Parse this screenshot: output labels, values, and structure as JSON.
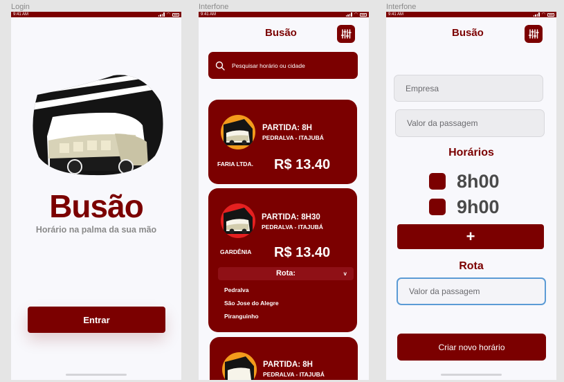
{
  "frames": {
    "login": "Login",
    "list": "Interfone",
    "form": "Interfone"
  },
  "status_time": "9:41 AM",
  "colors": {
    "brand": "#7b0000",
    "input_focus": "#5b9bd5"
  },
  "login": {
    "title": "Busão",
    "subtitle": "Horário na palma da sua mão",
    "enter_button": "Entrar",
    "logo_icon": "bus-icon"
  },
  "list": {
    "header_title": "Busão",
    "filter_icon": "sliders-icon",
    "search_placeholder": "Pesquisar horário ou cidade",
    "cards": [
      {
        "partida": "PARTIDA: 8H",
        "route": "PEDRALVA - ITAJUBÁ",
        "company": "FARIA LTDA.",
        "price": "R$ 13.40"
      },
      {
        "partida": "PARTIDA: 8H30",
        "route": "PEDRALVA - ITAJUBÁ",
        "company": "GARDÊNIA",
        "price": "R$ 13.40",
        "rota_label": "Rota:",
        "rota_chevron": "v",
        "stops": [
          "Pedralva",
          "São Jose do Alegre",
          "Piranguinho"
        ]
      },
      {
        "partida": "PARTIDA: 8H",
        "route": "PEDRALVA - ITAJUBÁ"
      }
    ]
  },
  "form": {
    "header_title": "Busão",
    "empresa_placeholder": "Empresa",
    "valor_placeholder": "Valor da passagem",
    "horarios_title": "Horários",
    "times": [
      "8h00",
      "9h00"
    ],
    "plus_label": "+",
    "rota_title": "Rota",
    "rota_placeholder": "Valor da passagem",
    "create_button": "Criar novo horário"
  }
}
